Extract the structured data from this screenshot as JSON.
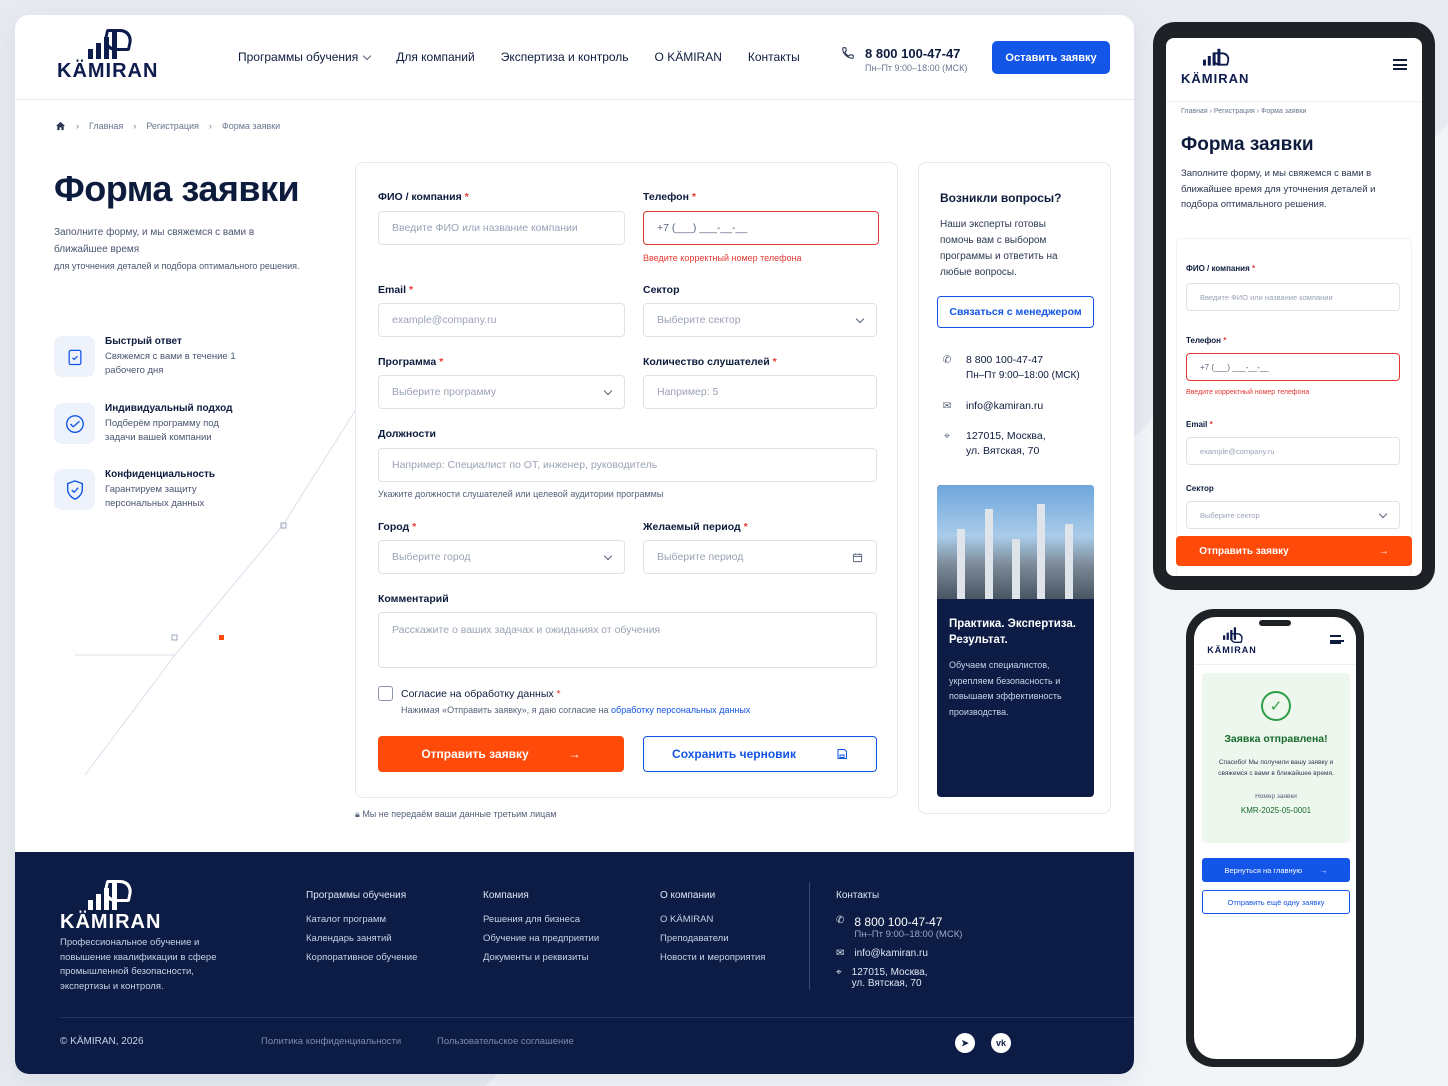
{
  "brand": {
    "name": "KÄMIRAN"
  },
  "nav": {
    "items": [
      "Программы обучения",
      "Для компаний",
      "Экспертиза и контроль",
      "О KÄMIRAN",
      "Контакты"
    ]
  },
  "header": {
    "phone": "8 800 100-47-47",
    "hours": "Пн–Пт 9:00–18:00 (МСК)",
    "cta": "Оставить заявку"
  },
  "breadcrumbs": [
    "Главная",
    "Регистрация",
    "Форма заявки"
  ],
  "page": {
    "title": "Форма заявки",
    "lead1": "Заполните форму, и мы свяжемся с вами в ближайшее время",
    "lead2": "для уточнения деталей и подбора оптимального решения."
  },
  "features": [
    {
      "title": "Быстрый ответ",
      "text": "Свяжемся с вами в течение 1 рабочего дня",
      "icon": "clipboard-icon"
    },
    {
      "title": "Индивидуальный подход",
      "text": "Подберём программу под задачи вашей компании",
      "icon": "handshake-icon"
    },
    {
      "title": "Конфиденциальность",
      "text": "Гарантируем защиту персональных данных",
      "icon": "shield-icon"
    }
  ],
  "form": {
    "fio": {
      "label": "ФИО / компания",
      "placeholder": "Введите ФИО или название компании"
    },
    "phone": {
      "label": "Телефон",
      "value": "+7 (___) ___-__-__",
      "error": "Введите корректный номер телефона"
    },
    "email": {
      "label": "Email",
      "placeholder": "example@company.ru"
    },
    "sector": {
      "label": "Сектор",
      "placeholder": "Выберите сектор"
    },
    "program": {
      "label": "Программа",
      "placeholder": "Выберите программу"
    },
    "count": {
      "label": "Количество слушателей",
      "placeholder": "Например: 5"
    },
    "positions": {
      "label": "Должности",
      "placeholder": "Например: Специалист по ОТ, инженер, руководитель",
      "hint": "Укажите должности слушателей или целевой аудитории программы"
    },
    "city": {
      "label": "Город",
      "placeholder": "Выберите город"
    },
    "period": {
      "label": "Желаемый период",
      "placeholder": "Выберите период"
    },
    "comment": {
      "label": "Комментарий",
      "placeholder": "Расскажите о ваших задачах и ожиданиях от обучения"
    },
    "consent": {
      "label": "Согласие на обработку данных",
      "note": "Нажимая «Отправить заявку», я даю согласие на",
      "link": "обработку персональных данных"
    },
    "submit": "Отправить заявку",
    "draft": "Сохранить черновик",
    "privacy": "Мы не передаём ваши данные третьим лицам"
  },
  "sidebar": {
    "title": "Возникли вопросы?",
    "text": "Наши эксперты готовы помочь вам с выбором программы и ответить на любые вопросы.",
    "button": "Связаться с менеджером",
    "phone": "8 800 100-47-47",
    "hours": "Пн–Пт 9:00–18:00 (МСК)",
    "email": "info@kamiran.ru",
    "address1": "127015, Москва,",
    "address2": "ул. Вятская, 70",
    "promo_title": "Практика. Экспертиза. Результат.",
    "promo_text": "Обучаем специалистов, укрепляем безопасность и повышаем эффективность производства."
  },
  "footer": {
    "desc": "Профессиональное обучение и повышение квалификации в сфере промышленной безопасности, экспертизы и контроля.",
    "cols": [
      {
        "title": "Программы обучения",
        "links": [
          "Каталог программ",
          "Календарь занятий",
          "Корпоративное обучение"
        ]
      },
      {
        "title": "Компания",
        "links": [
          "Решения для бизнеса",
          "Обучение на предприятии",
          "Документы и реквизиты"
        ]
      },
      {
        "title": "О компании",
        "links": [
          "О KÄMIRAN",
          "Преподаватели",
          "Новости и мероприятия"
        ]
      }
    ],
    "contacts_title": "Контакты",
    "copyright": "© KÄMIRAN, 2026",
    "policy": "Политика конфиденциальности",
    "terms": "Пользовательское соглашение"
  },
  "mobile": {
    "success_title": "Заявка отправлена!",
    "success_text": "Спасибо! Мы получили вашу заявку и свяжемся с вами в ближайшее время.",
    "order_label": "Номер заявки",
    "order_number": "KMR-2025-05-0001",
    "home": "Вернуться на главную",
    "again": "Отправить ещё одну заявку"
  },
  "colors": {
    "accent": "#1355e6",
    "cta": "#ff4a0a",
    "navy": "#0c1c45",
    "error": "#e53935",
    "success": "#2e9e44"
  }
}
